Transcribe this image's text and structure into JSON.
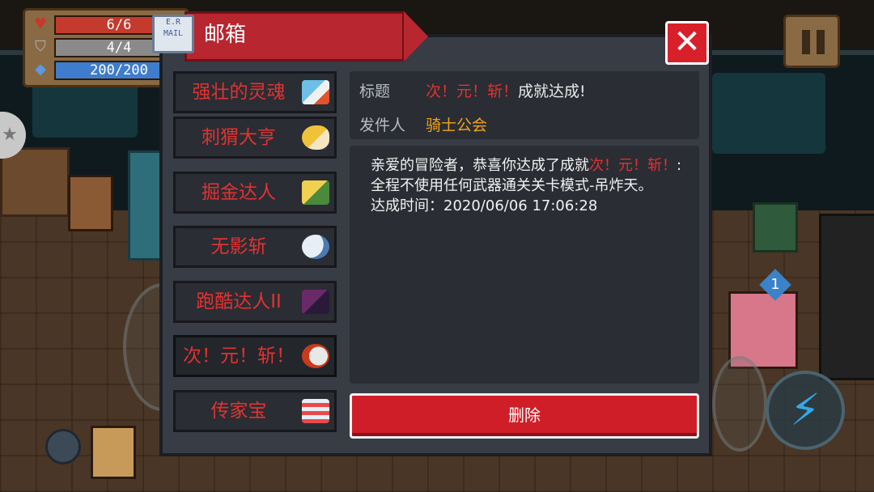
{
  "hud": {
    "hp": "6/6",
    "armor": "4/4",
    "energy": "200/200",
    "hp_icon": "heart-icon",
    "armor_icon": "shield-icon",
    "energy_icon": "diamond-icon"
  },
  "weapon_badge": "1",
  "mailbox": {
    "title": "邮箱",
    "icon_text": "E.R MAIL",
    "close_icon": "close-icon",
    "items": [
      {
        "label": "强壮的灵魂",
        "icon": "soul-icon"
      },
      {
        "label": "刺猬大亨",
        "icon": "hedgehog-icon"
      },
      {
        "label": "掘金达人",
        "icon": "gold-digger-icon"
      },
      {
        "label": "无影斩",
        "icon": "shadow-slash-icon"
      },
      {
        "label": "跑酷达人II",
        "icon": "parkour-icon"
      },
      {
        "label": "次！元！斩！",
        "icon": "dimension-slash-icon"
      },
      {
        "label": "传家宝",
        "icon": "heirloom-icon"
      }
    ],
    "selected_index": 5,
    "detail": {
      "subject_label": "标题",
      "subject_highlight": "次！元！斩！",
      "subject_rest": "成就达成!",
      "sender_label": "发件人",
      "sender": "骑士公会",
      "body_intro": "亲爱的冒险者，恭喜你达成了成就",
      "body_highlight": "次！元！斩！",
      "body_rest": ":全程不使用任何武器通关关卡模式-吊炸天。",
      "time_label": "达成时间：",
      "time": "2020/06/06 17:06:28"
    },
    "delete_label": "删除"
  },
  "colors": {
    "accent_red": "#e23232",
    "sender_orange": "#f2a31e",
    "banner_red": "#b82630",
    "panel_bg": "#383c44"
  }
}
